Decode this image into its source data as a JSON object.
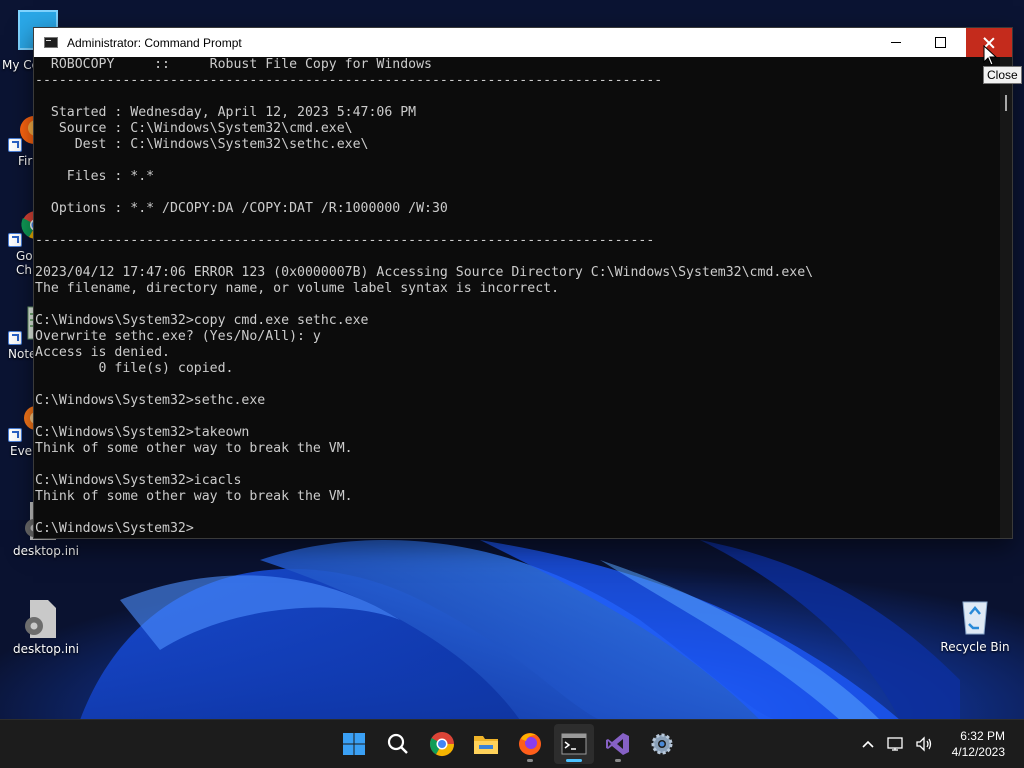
{
  "desktop": {
    "icons": [
      {
        "label": "My Co"
      },
      {
        "label": "Fir"
      },
      {
        "label": "Go\nChr"
      },
      {
        "label": "Note"
      },
      {
        "label": "Ever"
      },
      {
        "label": "desktop.ini"
      },
      {
        "label": "desktop.ini"
      },
      {
        "label": "Recycle Bin"
      }
    ]
  },
  "window": {
    "title": "Administrator: Command Prompt",
    "close_tooltip": "Close",
    "console_lines": [
      "  ROBOCOPY     ::     Robust File Copy for Windows",
      "-------------------------------------------------------------------------------",
      "",
      "  Started : Wednesday, April 12, 2023 5:47:06 PM",
      "   Source : C:\\Windows\\System32\\cmd.exe\\",
      "     Dest : C:\\Windows\\System32\\sethc.exe\\",
      "",
      "    Files : *.*",
      "",
      "  Options : *.* /DCOPY:DA /COPY:DAT /R:1000000 /W:30",
      "",
      "------------------------------------------------------------------------------",
      "",
      "2023/04/12 17:47:06 ERROR 123 (0x0000007B) Accessing Source Directory C:\\Windows\\System32\\cmd.exe\\",
      "The filename, directory name, or volume label syntax is incorrect.",
      "",
      "C:\\Windows\\System32>copy cmd.exe sethc.exe",
      "Overwrite sethc.exe? (Yes/No/All): y",
      "Access is denied.",
      "        0 file(s) copied.",
      "",
      "C:\\Windows\\System32>sethc.exe",
      "",
      "C:\\Windows\\System32>takeown",
      "Think of some other way to break the VM.",
      "",
      "C:\\Windows\\System32>icacls",
      "Think of some other way to break the VM.",
      "",
      "C:\\Windows\\System32>"
    ]
  },
  "taskbar": {
    "apps": [
      "start-icon",
      "search-icon",
      "chrome-icon",
      "file-explorer-icon",
      "firefox-icon",
      "command-prompt-icon",
      "visual-studio-icon",
      "settings-icon"
    ],
    "clock_time": "6:32 PM",
    "clock_date": "4/12/2023"
  },
  "colors": {
    "close_red": "#c42b1c",
    "console_bg": "#0c0c0c",
    "console_text": "#cccccc",
    "taskbar_bg": "#1c1c1c"
  }
}
